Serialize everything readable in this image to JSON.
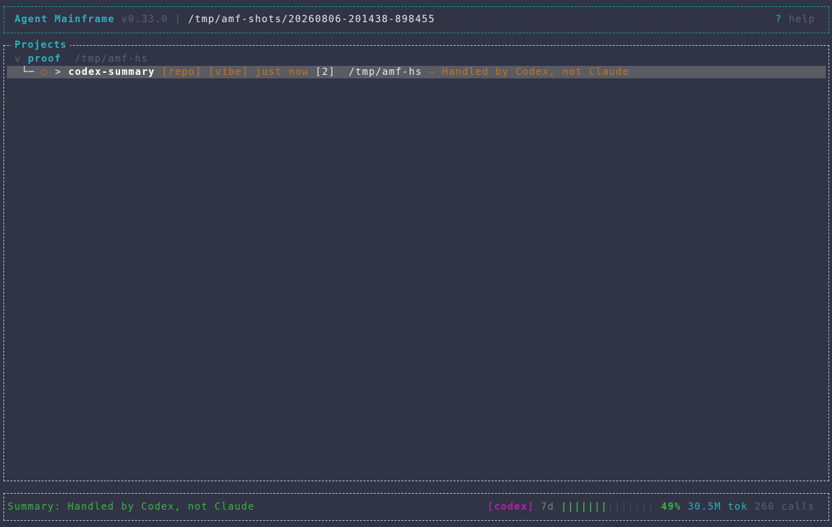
{
  "header": {
    "app_name": "Agent Mainframe",
    "version": "v0.33.0",
    "separator": "|",
    "path": "/tmp/amf-shots/20260806-201438-898455",
    "help_key": "?",
    "help_label": "help"
  },
  "projects": {
    "title": "Projects",
    "groups": [
      {
        "expander": "v",
        "name": "proof",
        "path": "/tmp/amf-hs",
        "sessions": [
          {
            "tree_glyph": "└─",
            "status_icon": "○",
            "cursor": ">",
            "name": "codex-summary",
            "tags": "[repo] [vibe]",
            "time": "just now",
            "count": "[2]",
            "path": "/tmp/amf-hs",
            "summary": "— Handled by Codex, not Claude"
          }
        ]
      }
    ]
  },
  "statusbar": {
    "summary": "Summary: Handled by Codex, not Claude",
    "agent": "[codex]",
    "period": "7d",
    "usage_bar_filled": "|||||||",
    "usage_bar_empty": "|||||||",
    "usage_percent": "49%",
    "usage_fraction": 0.49,
    "tokens": "30.5M",
    "tokens_unit": "tok",
    "calls": "260",
    "calls_unit": "calls"
  },
  "colors": {
    "background": "#313445",
    "accent_cyan": "#2bb3bd",
    "tag_orange": "#c8731a",
    "status_green": "#3bb34a",
    "agent_magenta": "#b41fae",
    "selected_row": "#5b5c63"
  }
}
